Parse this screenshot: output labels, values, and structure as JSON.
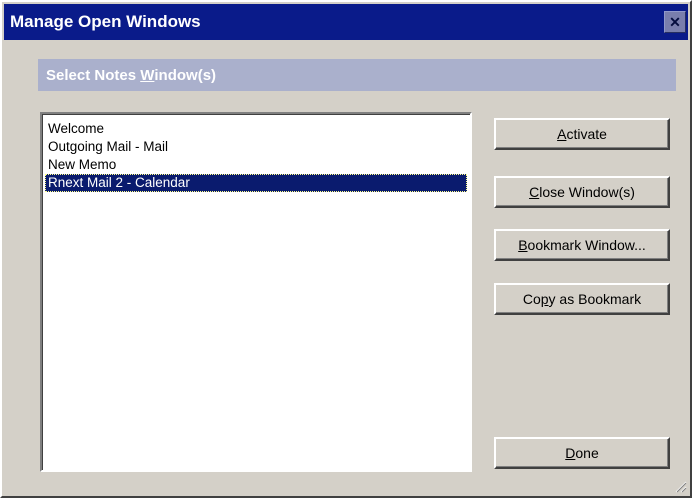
{
  "window": {
    "title": "Manage Open Windows",
    "close_glyph": "✕"
  },
  "section": {
    "header_pre": "Select Notes ",
    "header_ul": "W",
    "header_post": "indow(s)"
  },
  "list": {
    "items": [
      {
        "label": "Welcome",
        "selected": false
      },
      {
        "label": "Outgoing Mail - Mail",
        "selected": false
      },
      {
        "label": "New Memo",
        "selected": false
      },
      {
        "label": "Rnext Mail 2 - Calendar",
        "selected": true
      }
    ]
  },
  "buttons": {
    "activate": {
      "ul": "A",
      "rest": "ctivate",
      "pre": ""
    },
    "close_windows": {
      "ul": "C",
      "rest": "lose Window(s)",
      "pre": ""
    },
    "bookmark_window": {
      "ul": "B",
      "rest": "ookmark Window...",
      "pre": ""
    },
    "copy_bookmark": {
      "pre": "Co",
      "ul": "p",
      "rest": "y as Bookmark"
    },
    "done": {
      "ul": "D",
      "rest": "one",
      "pre": ""
    }
  },
  "colors": {
    "titlebar": "#0a1b8a",
    "selection": "#0a1b6e",
    "section_header": "#aab0cc",
    "face": "#d4d0c8"
  }
}
